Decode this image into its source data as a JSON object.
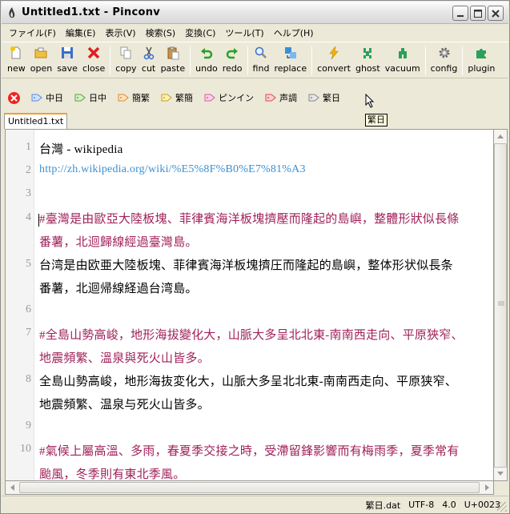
{
  "window": {
    "title": "Untitled1.txt - Pinconv"
  },
  "menu": [
    "ファイル(F)",
    "編集(E)",
    "表示(V)",
    "検索(S)",
    "変換(C)",
    "ツール(T)",
    "ヘルプ(H)"
  ],
  "toolbar": {
    "new": "new",
    "open": "open",
    "save": "save",
    "close": "close",
    "copy": "copy",
    "cut": "cut",
    "paste": "paste",
    "undo": "undo",
    "redo": "redo",
    "find": "find",
    "replace": "replace",
    "convert": "convert",
    "ghost": "ghost",
    "vacuum": "vacuum",
    "config": "config",
    "plugin": "plugin"
  },
  "convbar": [
    "中日",
    "日中",
    "簡繁",
    "繁簡",
    "ピンイン",
    "声調",
    "繁日"
  ],
  "tooltip": "繁日",
  "tab": "Untitled1.txt",
  "lines": [
    {
      "n": "1",
      "text": "台灣 - wikipedia"
    },
    {
      "n": "2",
      "text": "http://zh.wikipedia.org/wiki/%E5%8F%B0%E7%81%A3"
    },
    {
      "n": "3",
      "text": ""
    },
    {
      "n": "4",
      "text": "#臺灣是由歐亞大陸板塊、菲律賓海洋板塊擠壓而隆起的島嶼，整體形狀似長條",
      "cont": "番薯，北迴歸線經過臺灣島。"
    },
    {
      "n": "5",
      "text": "台湾是由欧亜大陸板塊、菲律賓海洋板塊擠圧而隆起的島嶼，整体形状似長条",
      "cont": "番薯，北迴帰線経過台湾島。"
    },
    {
      "n": "6",
      "text": ""
    },
    {
      "n": "7",
      "text": "#全島山勢高峻，地形海拔變化大，山脈大多呈北北東-南南西走向、平原狹窄、",
      "cont": "地震頻繁、溫泉與死火山皆多。"
    },
    {
      "n": "8",
      "text": "全島山勢高峻，地形海抜変化大，山脈大多呈北北東-南南西走向、平原狭窄、",
      "cont": "地震頻繁、温泉与死火山皆多。"
    },
    {
      "n": "9",
      "text": ""
    },
    {
      "n": "10",
      "text": "#氣候上屬高溫、多雨，春夏季交接之時，受滯留鋒影響而有梅雨季，夏季常有",
      "cont": "颱風，冬季則有東北季風。"
    }
  ],
  "status": {
    "file": "繁日.dat",
    "encoding": "UTF-8",
    "version": "4.0",
    "codepoint": "U+0023"
  },
  "colors": {
    "comment": "#a0205a",
    "link": "#3c8fd0",
    "text": "#000000"
  }
}
